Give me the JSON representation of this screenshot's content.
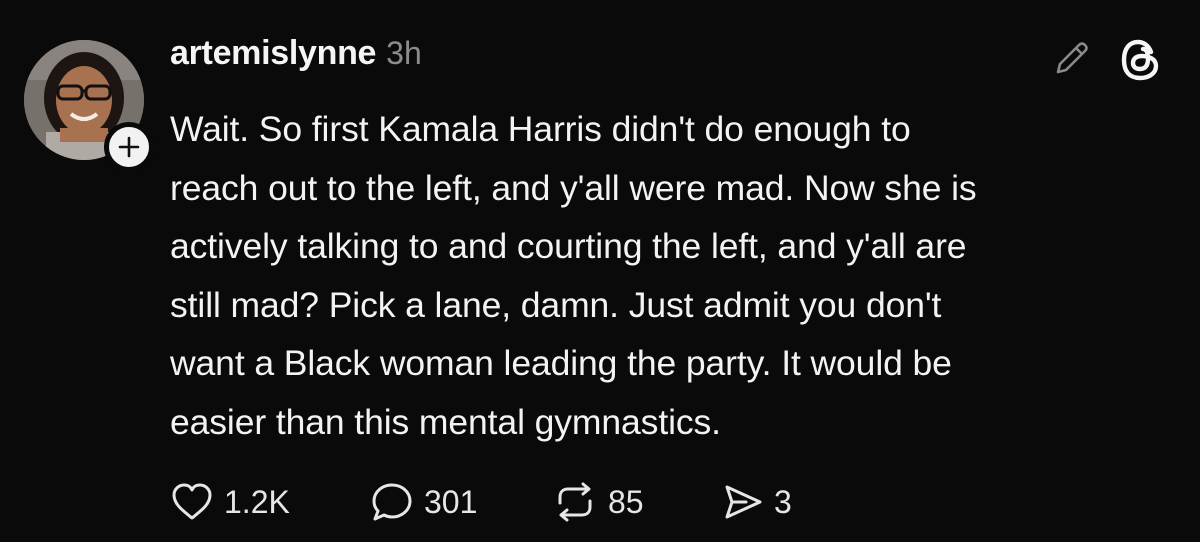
{
  "post": {
    "username": "artemislynne",
    "timestamp": "3h",
    "text": "Wait. So first Kamala Harris didn't do enough to\nreach out to the left, and y'all were mad. Now she is\nactively talking to and courting the left, and y'all are\nstill mad? Pick a lane, damn. Just admit you don't\nwant a Black woman leading the party. It would be\neasier than this mental gymnastics.",
    "icons": {
      "edit": "pencil-icon",
      "brand": "threads-logo-icon",
      "follow": "plus-icon",
      "like": "heart-icon",
      "reply": "comment-bubble-icon",
      "repost": "repost-arrows-icon",
      "share": "send-icon"
    },
    "stats": {
      "likes": "1.2K",
      "replies": "301",
      "reposts": "85",
      "shares": "3"
    }
  },
  "colors": {
    "background": "#0a0a0a",
    "text": "#f3f3f3",
    "muted": "#8c8c8c"
  }
}
